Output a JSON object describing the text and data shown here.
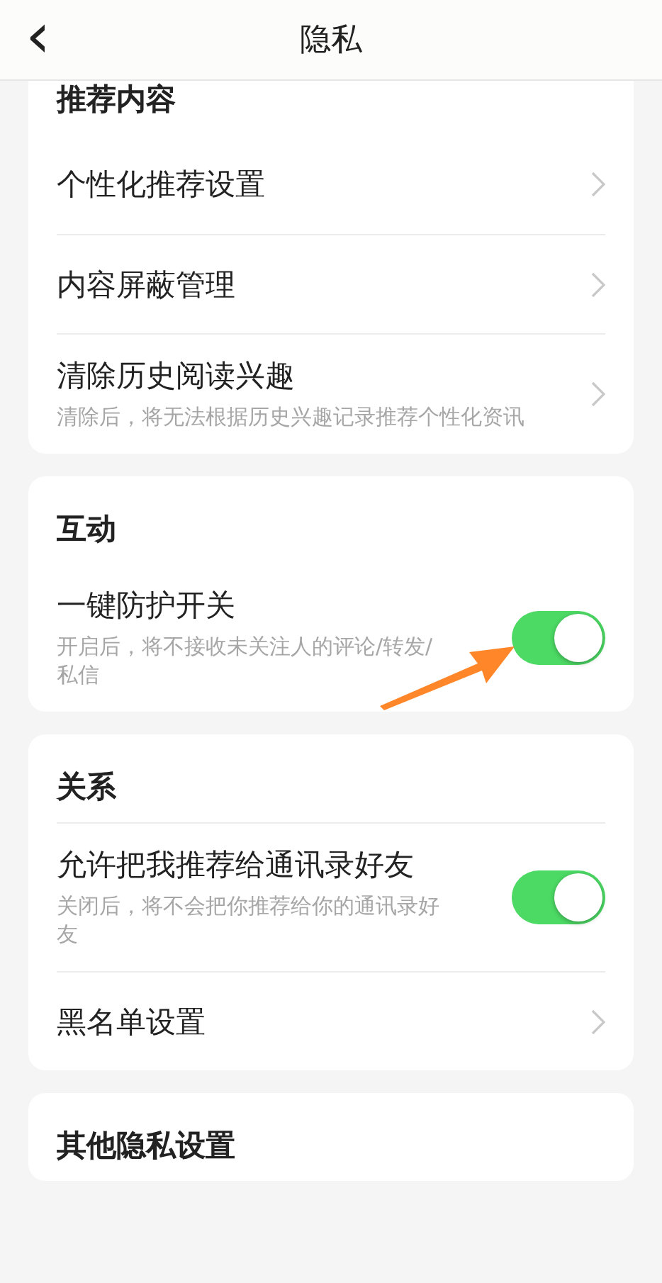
{
  "header": {
    "back": "‹",
    "title": "隐私"
  },
  "sections": [
    {
      "title": "推荐内容",
      "items": [
        {
          "kind": "link",
          "label": "个性化推荐设置"
        },
        {
          "kind": "link",
          "label": "内容屏蔽管理"
        },
        {
          "kind": "link",
          "label": "清除历史阅读兴趣",
          "description": "清除后，将无法根据历史兴趣记录推荐个性化资讯"
        }
      ]
    },
    {
      "title": "互动",
      "items": [
        {
          "kind": "toggle",
          "label": "一键防护开关",
          "description": "开启后，将不接收未关注人的评论/转发/私信",
          "on": true
        }
      ]
    },
    {
      "title": "关系",
      "items": [
        {
          "kind": "toggle",
          "label": "允许把我推荐给通讯录好友",
          "description": "关闭后，将不会把你推荐给你的通讯录好友",
          "on": true
        },
        {
          "kind": "link",
          "label": "黑名单设置"
        }
      ]
    },
    {
      "title": "其他隐私设置"
    }
  ]
}
